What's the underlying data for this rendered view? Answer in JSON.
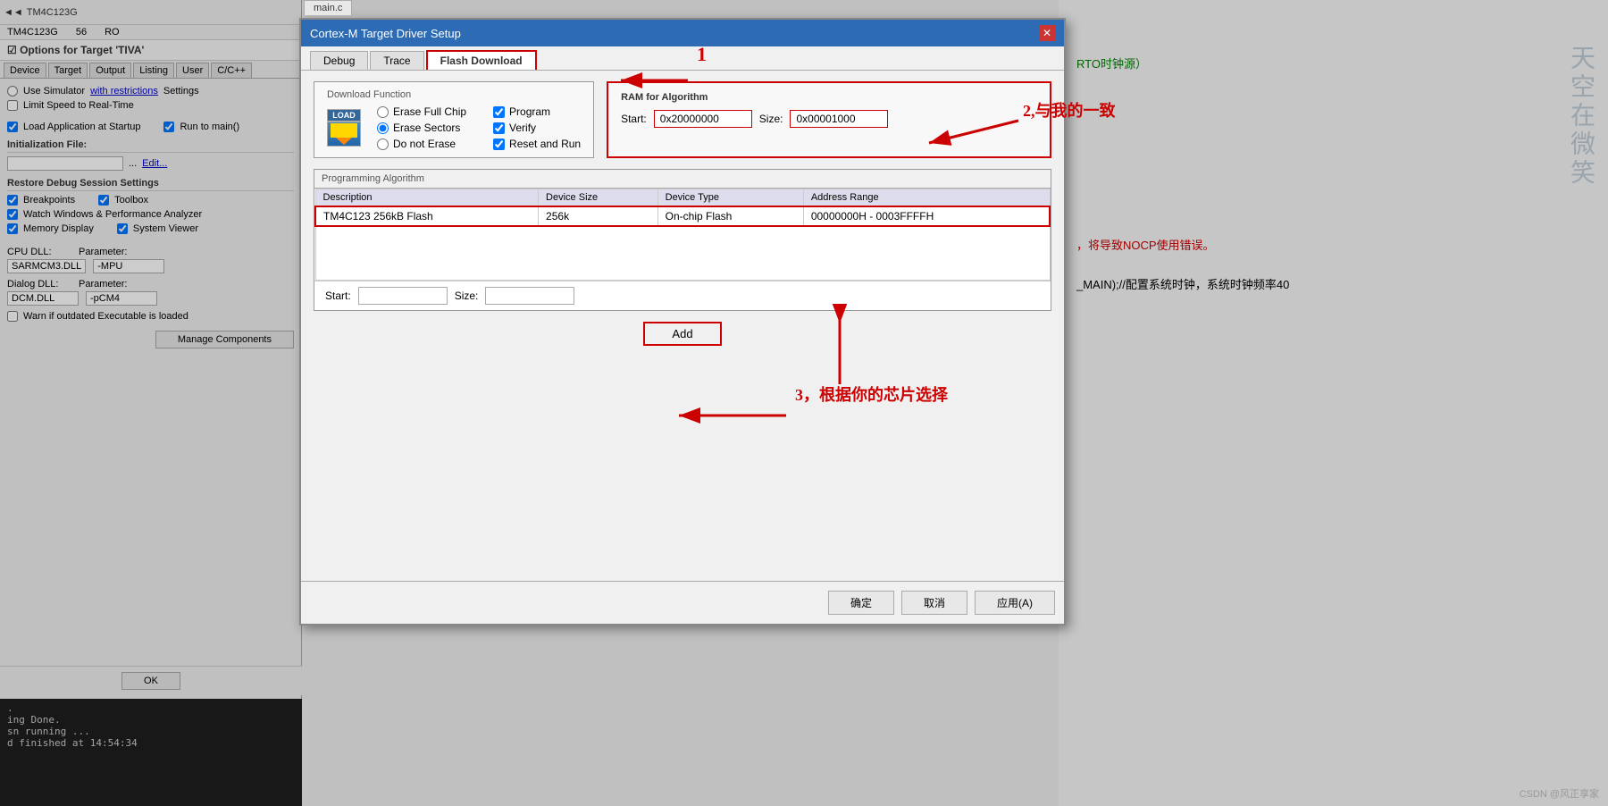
{
  "window": {
    "title": "Cortex-M Target Driver Setup",
    "close_btn": "✕"
  },
  "top_bar": {
    "file_tab": "main.c",
    "target_label": "TM4C123G",
    "col1": "56",
    "col2": "RO"
  },
  "left_panel": {
    "options_title": "Options for Target 'TIVA'",
    "tabs": [
      "Device",
      "Target",
      "Output",
      "Listing",
      "User",
      "C/C++"
    ],
    "use_simulator": "Use Simulator",
    "with_restrictions": "with restrictions",
    "settings_btn": "Settings",
    "limit_speed": "Limit Speed to Real-Time",
    "load_app": "Load Application at Startup",
    "run_to_main": "Run to main()",
    "init_file_label": "Initialization File:",
    "edit_btn": "Edit...",
    "restore_debug": "Restore Debug Session Settings",
    "breakpoints": "Breakpoints",
    "toolbox": "Toolbox",
    "watch_windows": "Watch Windows & Performance Analyzer",
    "memory_display": "Memory Display",
    "system_viewer": "System Viewer",
    "cpu_dll_label": "CPU DLL:",
    "cpu_dll_value": "SARMCM3.DLL",
    "param_label": "Parameter:",
    "cpu_param": "-MPU",
    "dialog_dll_label": "Dialog DLL:",
    "dialog_dll_value": "DCM.DLL",
    "dialog_param": "-pCM4",
    "warn_outdated": "Warn if outdated Executable is loaded",
    "manage_components": "Manage Components",
    "ok_btn": "OK"
  },
  "console": {
    "lines": [
      ".",
      "ing Done.",
      "",
      "sn running ...",
      "d finished at 14:54:34"
    ]
  },
  "dialog": {
    "title": "Cortex-M Target Driver Setup",
    "tabs": [
      "Debug",
      "Trace",
      "Flash Download"
    ],
    "active_tab": "Flash Download",
    "download_function": {
      "title": "Download Function",
      "radio_options": [
        "Erase Full Chip",
        "Erase Sectors",
        "Do not Erase"
      ],
      "selected_radio": "Erase Sectors",
      "check_options": [
        "Program",
        "Verify",
        "Reset and Run"
      ],
      "checked": [
        true,
        true,
        true
      ]
    },
    "ram_algorithm": {
      "title": "RAM for Algorithm",
      "start_label": "Start:",
      "start_value": "0x20000000",
      "size_label": "Size:",
      "size_value": "0x00001000"
    },
    "programming_algorithm": {
      "title": "Programming Algorithm",
      "columns": [
        "Description",
        "Device Size",
        "Device Type",
        "Address Range"
      ],
      "rows": [
        {
          "description": "TM4C123 256kB Flash",
          "device_size": "256k",
          "device_type": "On-chip Flash",
          "address_range": "00000000H - 0003FFFFH"
        }
      ],
      "start_label": "Start:",
      "start_value": "",
      "size_label": "Size:",
      "size_value": ""
    },
    "add_btn": "Add",
    "confirm_buttons": {
      "ok": "确定",
      "cancel": "取消",
      "apply": "应用(A)"
    }
  },
  "annotations": {
    "label1": "1",
    "label2": "2,与我的一致",
    "label3": "3，根据你的芯片选择"
  },
  "right_code": {
    "comment1": "RTO时钟源）",
    "comment2": "，将导致NOCP使用错误。",
    "comment3": "_MAIN);//配置系统时钟，系统时钟频率40"
  },
  "vertical_chinese": "天空在微笑",
  "csdn": "CSDN @风正享家"
}
